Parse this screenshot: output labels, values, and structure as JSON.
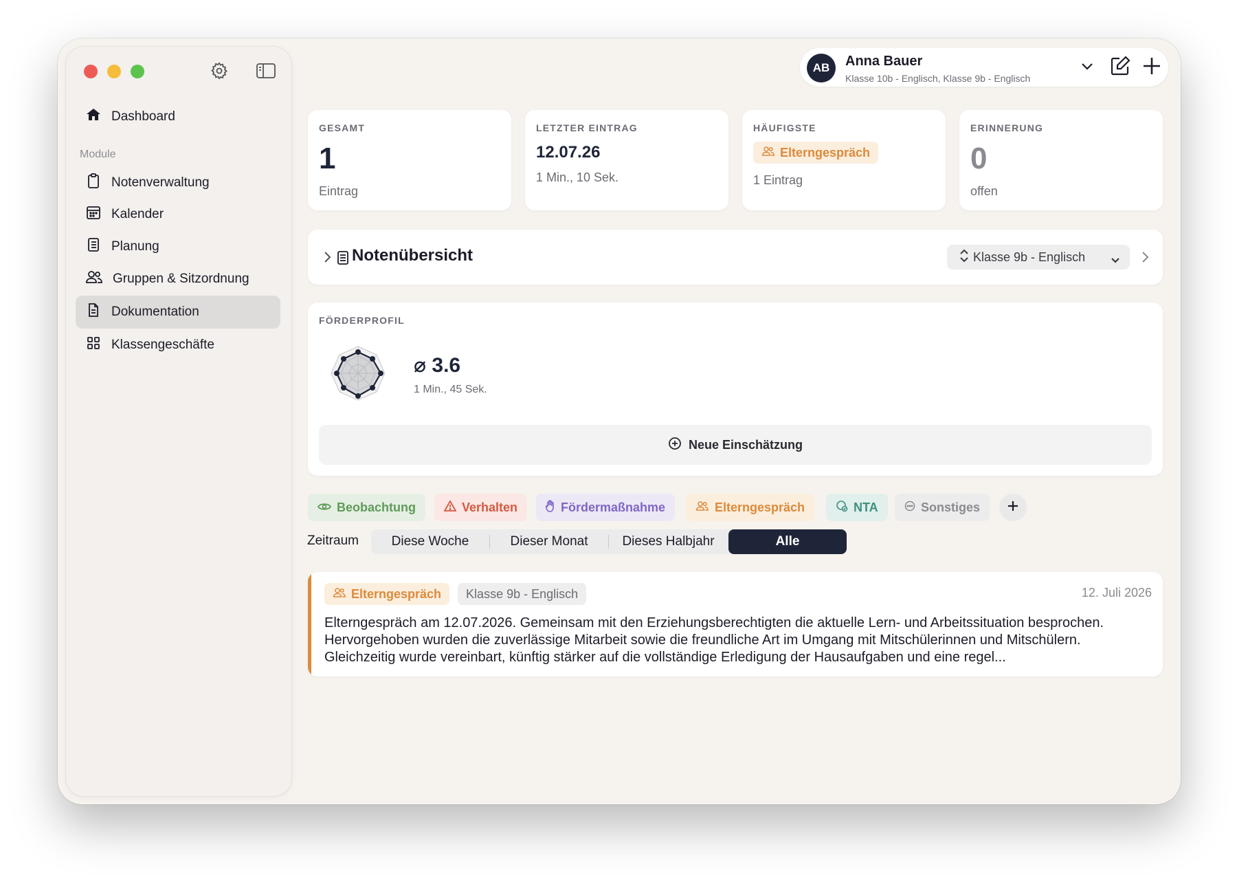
{
  "sidebar": {
    "dashboard": "Dashboard",
    "section_label": "Module",
    "items": [
      {
        "label": "Notenverwaltung"
      },
      {
        "label": "Kalender"
      },
      {
        "label": "Planung"
      },
      {
        "label": "Gruppen & Sitzordnung"
      },
      {
        "label": "Dokumentation"
      },
      {
        "label": "Klassengeschäfte"
      }
    ],
    "active_item": "Dokumentation"
  },
  "profile": {
    "initials": "AB",
    "name": "Anna Bauer",
    "classes": "Klasse 10b - Englisch, Klasse 9b - Englisch"
  },
  "stats": {
    "total": {
      "label": "GESAMT",
      "value": "1",
      "unit": "Eintrag"
    },
    "last": {
      "label": "LETZTER EINTRAG",
      "value": "12.07.26",
      "sub": "1 Min., 10 Sek."
    },
    "frequent": {
      "label": "HÄUFIGSTE",
      "tag": "Elterngespräch",
      "sub": "1 Eintrag"
    },
    "reminder": {
      "label": "ERINNERUNG",
      "value": "0",
      "unit": "offen"
    }
  },
  "noten": {
    "title": "Notenübersicht",
    "selected_class": "Klasse 9b - Englisch"
  },
  "foerderprofil": {
    "label": "FÖRDERPROFIL",
    "average": "⌀ 3.6",
    "sub": "1 Min., 45 Sek.",
    "new_button": "Neue Einschätzung"
  },
  "categories": [
    {
      "label": "Beobachtung",
      "icon": "eye-icon"
    },
    {
      "label": "Verhalten",
      "icon": "warning-icon"
    },
    {
      "label": "Fördermaßnahme",
      "icon": "hand-icon"
    },
    {
      "label": "Elterngespräch",
      "icon": "people-icon"
    },
    {
      "label": "NTA",
      "icon": "badge-icon"
    },
    {
      "label": "Sonstiges",
      "icon": "more-icon"
    }
  ],
  "zeitraum": {
    "label": "Zeitraum",
    "options": [
      "Diese Woche",
      "Dieser Monat",
      "Dieses Halbjahr",
      "Alle"
    ],
    "selected": "Alle"
  },
  "entries": [
    {
      "tag": "Elterngespräch",
      "class": "Klasse 9b - Englisch",
      "date": "12. Juli 2026",
      "text": "Elterngespräch am 12.07.2026. Gemeinsam mit den Erziehungsberechtigten die aktuelle Lern- und Arbeitssituation besprochen. Hervorgehoben wurden die zuverlässige Mitarbeit sowie die freundliche Art im Umgang mit Mitschülerinnen und Mitschülern. Gleichzeitig wurde vereinbart, künftig stärker auf die vollständige Erledigung der Hausaufgaben und eine regel..."
    }
  ],
  "colors": {
    "accent_dark": "#1f2538",
    "orange": "#dc8a3c",
    "red": "#ee5b57",
    "yellow": "#f5bd3b",
    "green": "#5cc34c"
  }
}
